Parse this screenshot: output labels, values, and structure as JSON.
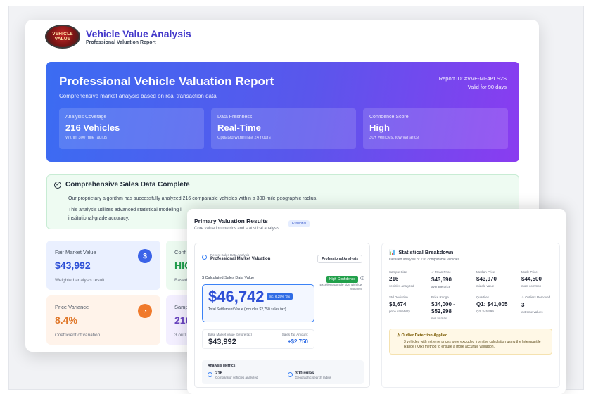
{
  "app": {
    "title": "Vehicle Value Analysis",
    "subtitle": "Professional Valuation Report",
    "logo_text": "VEHICLE VALUE"
  },
  "hero": {
    "title": "Professional Vehicle Valuation Report",
    "subtitle": "Comprehensive market analysis based on real transaction data",
    "report_id": "Report ID: #VVE-MF4PLS2S",
    "valid": "Valid for 90 days",
    "stats": [
      {
        "label": "Analysis Coverage",
        "value": "216 Vehicles",
        "note": "Within 300 mile radius"
      },
      {
        "label": "Data Freshness",
        "value": "Real-Time",
        "note": "Updated within last 24 hours"
      },
      {
        "label": "Confidence Score",
        "value": "High",
        "note": "30+ vehicles, low variance"
      }
    ]
  },
  "complete": {
    "title": "Comprehensive Sales Data Complete",
    "line1": "Our proprietary algorithm has successfully analyzed 216 comparable vehicles within a 300-mile geographic radius.",
    "line2": "This analysis utilizes advanced statistical modeling i",
    "line3": "institutional-grade accuracy."
  },
  "metrics": {
    "fair": {
      "label": "Fair Market Value",
      "value": "$43,992",
      "note": "Weighted analysis result",
      "icon": "dollar-icon"
    },
    "conf": {
      "label": "Conf",
      "value": "HIG",
      "note": "Based"
    },
    "variance": {
      "label": "Price Variance",
      "value": "8.4%",
      "note": "Coefficient of variation",
      "icon": "gauge-icon"
    },
    "samp": {
      "label": "Samp",
      "value": "216",
      "note": "3 outli"
    }
  },
  "primary": {
    "title": "Primary Valuation Results",
    "badge": "Essential",
    "subtitle": "Core valuation metrics and statistical analysis",
    "recent_label": "Recent Sales Data Analysis",
    "recent_title": "Professional Market Valuation",
    "pro_badge": "Professional Analysis",
    "calc_label": "$ Calculated Sales Data Value",
    "high_conf": "High Confidence",
    "excellent": "Excellent sample size with low variance",
    "value": "$46,742",
    "tax_badge": "Inc. 6.25% Tax",
    "total_note": "Total Settlement Value (includes $2,750 sales tax)",
    "base_label": "Base Market Value (before tax)",
    "base_value": "$43,992",
    "tax_label": "Sales Tax Amount:",
    "tax_value": "+$2,750",
    "analysis_title": "Analysis Metrics",
    "m1_value": "216",
    "m1_desc": "Comparator vehicles analyzed",
    "m2_value": "300 miles",
    "m2_desc": "Geographic search radius"
  },
  "stat_breakdown": {
    "title": "Statistical Breakdown",
    "subtitle": "Detailed analysis of 216 comparable vehicles",
    "cells": [
      {
        "label": "Sample Size",
        "value": "216",
        "note": "vehicles analyzed"
      },
      {
        "label": "↗ Mean Price",
        "value": "$43,690",
        "note": "average price"
      },
      {
        "label": "Median Price",
        "value": "$43,970",
        "note": "middle value"
      },
      {
        "label": "Mode Price",
        "value": "$44,500",
        "note": "most common"
      },
      {
        "label": "Std Deviation",
        "value": "$3,674",
        "note": "price variability"
      },
      {
        "label": "Price Range",
        "value": "$34,000 - $52,998",
        "note": "min to max"
      },
      {
        "label": "Quartiles",
        "value": "Q1: $41,005",
        "note": "Q3: $45,999"
      },
      {
        "label": "⚠ Outliers Removed",
        "value": "3",
        "note": "extreme values"
      }
    ],
    "outlier_title": "Outlier Detection Applied",
    "outlier_text": "3 vehicles with extreme prices were excluded from the calculation using the Interquartile Range (IQR) method to ensure a more accurate valuation."
  }
}
